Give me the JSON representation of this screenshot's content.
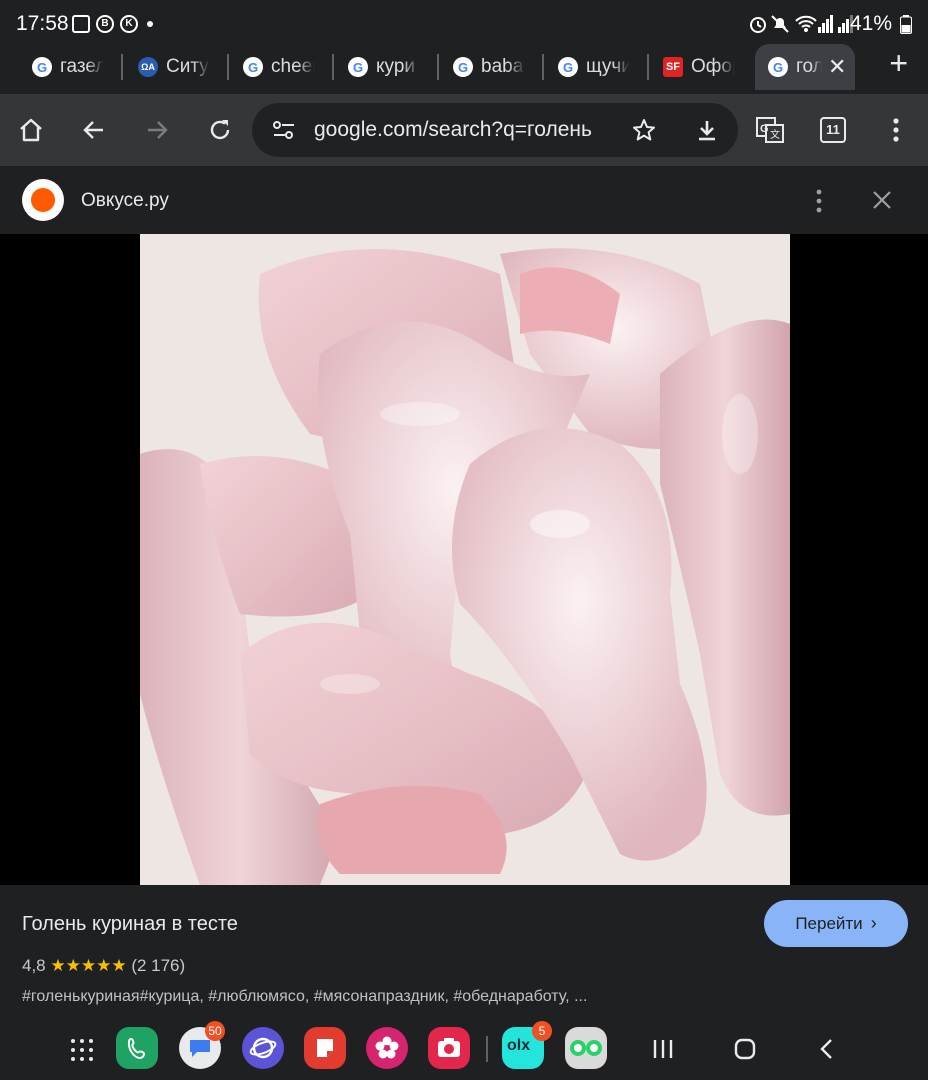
{
  "status_bar": {
    "time": "17:58",
    "left_icons": [
      "image-icon",
      "b-icon",
      "vk-icon",
      "dot-icon"
    ],
    "right_icons": [
      "alarm-icon",
      "mute-icon",
      "wifi-icon",
      "signal-icon",
      "signal-icon"
    ],
    "battery": "41%"
  },
  "tabs": [
    {
      "label": "газел",
      "favicon": "google-icon"
    },
    {
      "label": "Ситу",
      "favicon": "site-icon"
    },
    {
      "label": "cheer",
      "favicon": "google-icon"
    },
    {
      "label": "кури",
      "favicon": "google-icon"
    },
    {
      "label": "baba",
      "favicon": "google-icon"
    },
    {
      "label": "щучи",
      "favicon": "google-icon"
    },
    {
      "label": "Офор",
      "favicon": "sf-icon",
      "favicon_text": "SF"
    },
    {
      "label": "гол",
      "favicon": "google-icon",
      "active": true
    }
  ],
  "toolbar": {
    "url": "google.com/search?q=голень",
    "tab_count": "11"
  },
  "source": {
    "name": "Овкусе.ру",
    "logo_color": "#ff5a00"
  },
  "result": {
    "title": "Голень куриная в тесте",
    "rating_value": "4,8",
    "stars": "★★★★★",
    "rating_count": "(2 176)",
    "tags": "#голенькуриная#курица, #люблюмясо, #мясонапраздник, #обеднаработу, ...",
    "go_button": "Перейти",
    "go_button_color": "#8ab4f8"
  },
  "nav_bar": {
    "apps": [
      {
        "name": "phone-app",
        "color": "#1ea362"
      },
      {
        "name": "messages-app",
        "color": "#e8eaed",
        "badge": "50"
      },
      {
        "name": "internet-app",
        "color": "#5b54d6"
      },
      {
        "name": "notes-app",
        "color": "#e23b2f"
      },
      {
        "name": "gallery-app",
        "color": "#d6246e"
      },
      {
        "name": "camera-app",
        "color": "#e3264b"
      },
      {
        "name": "olx-app",
        "color": "#23e5db",
        "badge": "5"
      },
      {
        "name": "dual-whatsapp-app",
        "color": "#dadada"
      }
    ]
  }
}
